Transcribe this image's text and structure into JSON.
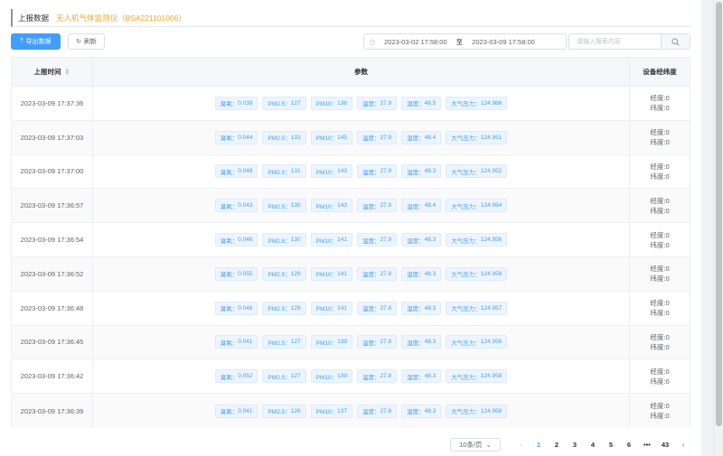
{
  "header": {
    "title": "上报数据",
    "device": "无人机气体监测仪（BSA221101006）"
  },
  "toolbar": {
    "export_label": "导出数据",
    "refresh_label": "刷新",
    "date_start": "2023-03-02 17:58:00",
    "date_separator": "至",
    "date_end": "2023-03-09 17:58:00",
    "search_placeholder": "请输入搜索内容"
  },
  "table": {
    "columns": [
      "上报时间",
      "参数",
      "设备经纬度"
    ],
    "param_labels": [
      "臭氧：",
      "PM2.5：",
      "PM10：",
      "温度：",
      "湿度：",
      "大气压力："
    ],
    "lon_label": "经度:0",
    "lat_label": "纬度:0",
    "rows": [
      {
        "time": "2023-03-09 17:37:36",
        "params": [
          "0.039",
          "127",
          "136",
          "27.9",
          "48.5",
          "124.966"
        ]
      },
      {
        "time": "2023-03-09 17:37:03",
        "params": [
          "0.044",
          "133",
          "145",
          "27.9",
          "48.4",
          "124.951"
        ]
      },
      {
        "time": "2023-03-09 17:37:00",
        "params": [
          "0.048",
          "131",
          "143",
          "27.9",
          "48.3",
          "124.952"
        ]
      },
      {
        "time": "2023-03-09 17:36:57",
        "params": [
          "0.043",
          "130",
          "143",
          "27.9",
          "48.4",
          "124.954"
        ]
      },
      {
        "time": "2023-03-09 17:36:54",
        "params": [
          "0.046",
          "130",
          "141",
          "27.9",
          "48.3",
          "124.956"
        ]
      },
      {
        "time": "2023-03-09 17:36:52",
        "params": [
          "0.055",
          "129",
          "141",
          "27.8",
          "48.3",
          "124.958"
        ]
      },
      {
        "time": "2023-03-09 17:36:48",
        "params": [
          "0.046",
          "129",
          "141",
          "27.8",
          "48.3",
          "124.957"
        ]
      },
      {
        "time": "2023-03-09 17:36:45",
        "params": [
          "0.041",
          "127",
          "139",
          "27.8",
          "48.3",
          "124.958"
        ]
      },
      {
        "time": "2023-03-09 17:36:42",
        "params": [
          "0.052",
          "127",
          "139",
          "27.8",
          "48.3",
          "124.958"
        ]
      },
      {
        "time": "2023-03-09 17:36:39",
        "params": [
          "0.041",
          "126",
          "137",
          "27.8",
          "48.3",
          "124.958"
        ]
      }
    ]
  },
  "pagination": {
    "page_size_label": "10条/页",
    "pages": [
      "1",
      "2",
      "3",
      "4",
      "5",
      "6",
      "•••",
      "43"
    ],
    "current_page": "1"
  },
  "colors": {
    "primary": "#409eff",
    "device_accent": "#f5a623",
    "tag_bg": "#ecf5ff"
  },
  "icons": [
    "upload-icon",
    "refresh-icon",
    "clock-icon",
    "search-icon",
    "sort-icon",
    "chevron-left-icon",
    "chevron-right-icon",
    "chevron-down-icon"
  ]
}
